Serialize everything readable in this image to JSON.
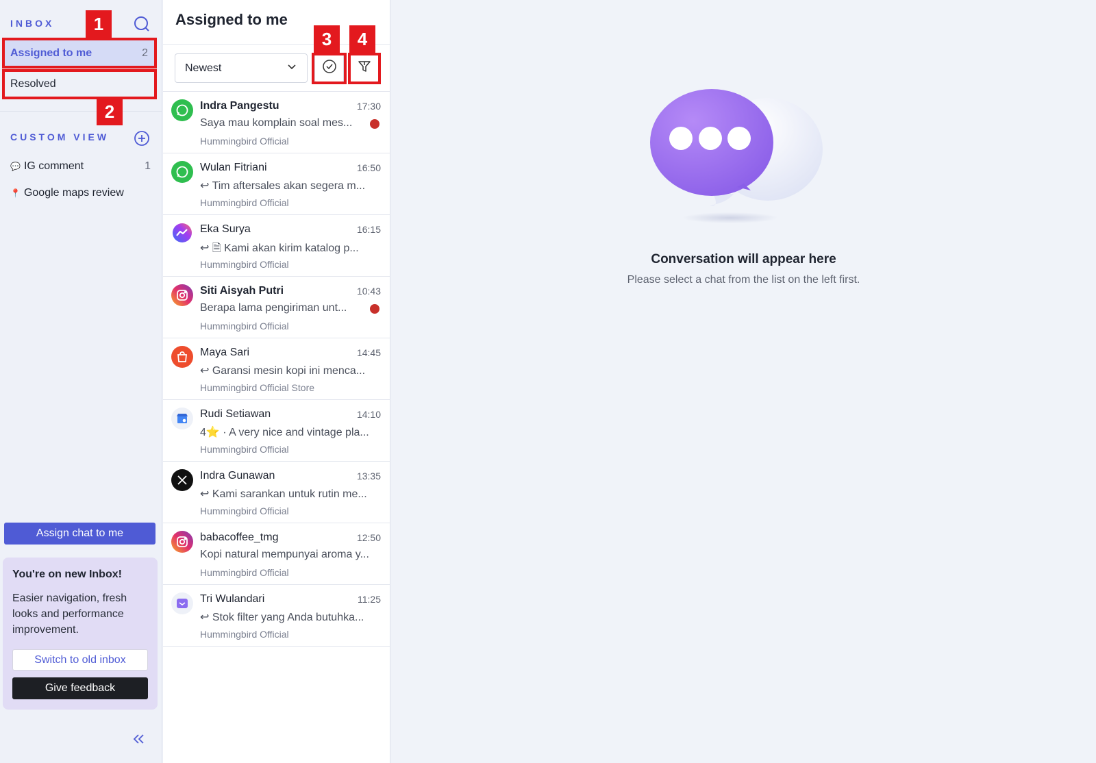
{
  "sidebar": {
    "inbox_heading": "INBOX",
    "items": [
      {
        "label": "Assigned to me",
        "count": "2"
      },
      {
        "label": "Resolved"
      }
    ],
    "custom_view_heading": "CUSTOM VIEW",
    "custom_views": [
      {
        "label": "IG comment",
        "emoji": "💬",
        "count": "1"
      },
      {
        "label": "Google maps review",
        "emoji": "📍"
      }
    ],
    "assign_button": "Assign chat to me",
    "promo": {
      "title": "You're on new Inbox!",
      "body": "Easier navigation, fresh looks and performance improvement.",
      "switch_button": "Switch to old inbox",
      "feedback_button": "Give feedback"
    }
  },
  "list": {
    "title": "Assigned to me",
    "sort_value": "Newest",
    "chats": [
      {
        "name": "Indra Pangestu",
        "time": "17:30",
        "preview": "Saya mau komplain soal mes...",
        "source": "Hummingbird Official",
        "channel": "whatsapp",
        "unread": true
      },
      {
        "name": "Wulan Fitriani",
        "time": "16:50",
        "preview": "↩ Tim aftersales akan segera m...",
        "source": "Hummingbird Official",
        "channel": "whatsapp",
        "unread": false
      },
      {
        "name": "Eka Surya",
        "time": "16:15",
        "preview": "↩ 🗎 Kami akan kirim katalog p...",
        "source": "Hummingbird Official",
        "channel": "messenger",
        "unread": false
      },
      {
        "name": "Siti Aisyah Putri",
        "time": "10:43",
        "preview": "Berapa lama pengiriman unt...",
        "source": "Hummingbird Official",
        "channel": "instagram",
        "unread": true
      },
      {
        "name": "Maya Sari",
        "time": "14:45",
        "preview": "↩ Garansi mesin kopi ini menca...",
        "source": "Hummingbird Official Store",
        "channel": "shopee",
        "unread": false
      },
      {
        "name": "Rudi Setiawan",
        "time": "14:10",
        "preview": "4⭐ · A very nice and vintage pla...",
        "source": "Hummingbird Official",
        "channel": "google-business",
        "unread": false
      },
      {
        "name": "Indra Gunawan",
        "time": "13:35",
        "preview": "↩ Kami sarankan untuk rutin me...",
        "source": "Hummingbird Official",
        "channel": "x",
        "unread": false
      },
      {
        "name": "babacoffee_tmg",
        "time": "12:50",
        "preview": "Kopi natural mempunyai aroma y...",
        "source": "Hummingbird Official",
        "channel": "instagram",
        "unread": false
      },
      {
        "name": "Tri Wulandari",
        "time": "11:25",
        "preview": "↩ Stok filter yang Anda butuhka...",
        "source": "Hummingbird Official",
        "channel": "email",
        "unread": false
      }
    ]
  },
  "main": {
    "empty_title": "Conversation will appear here",
    "empty_subtitle": "Please select a chat from the list on the left first."
  },
  "annotations": [
    "1",
    "2",
    "3",
    "4"
  ],
  "colors": {
    "accent": "#4f5bd5",
    "annotation_red": "#e3191e",
    "unread_dot": "#c8302a",
    "whatsapp": "#2fbe4f",
    "instagram": "#e1306c",
    "shopee": "#ee4d2d",
    "x": "#111111"
  }
}
